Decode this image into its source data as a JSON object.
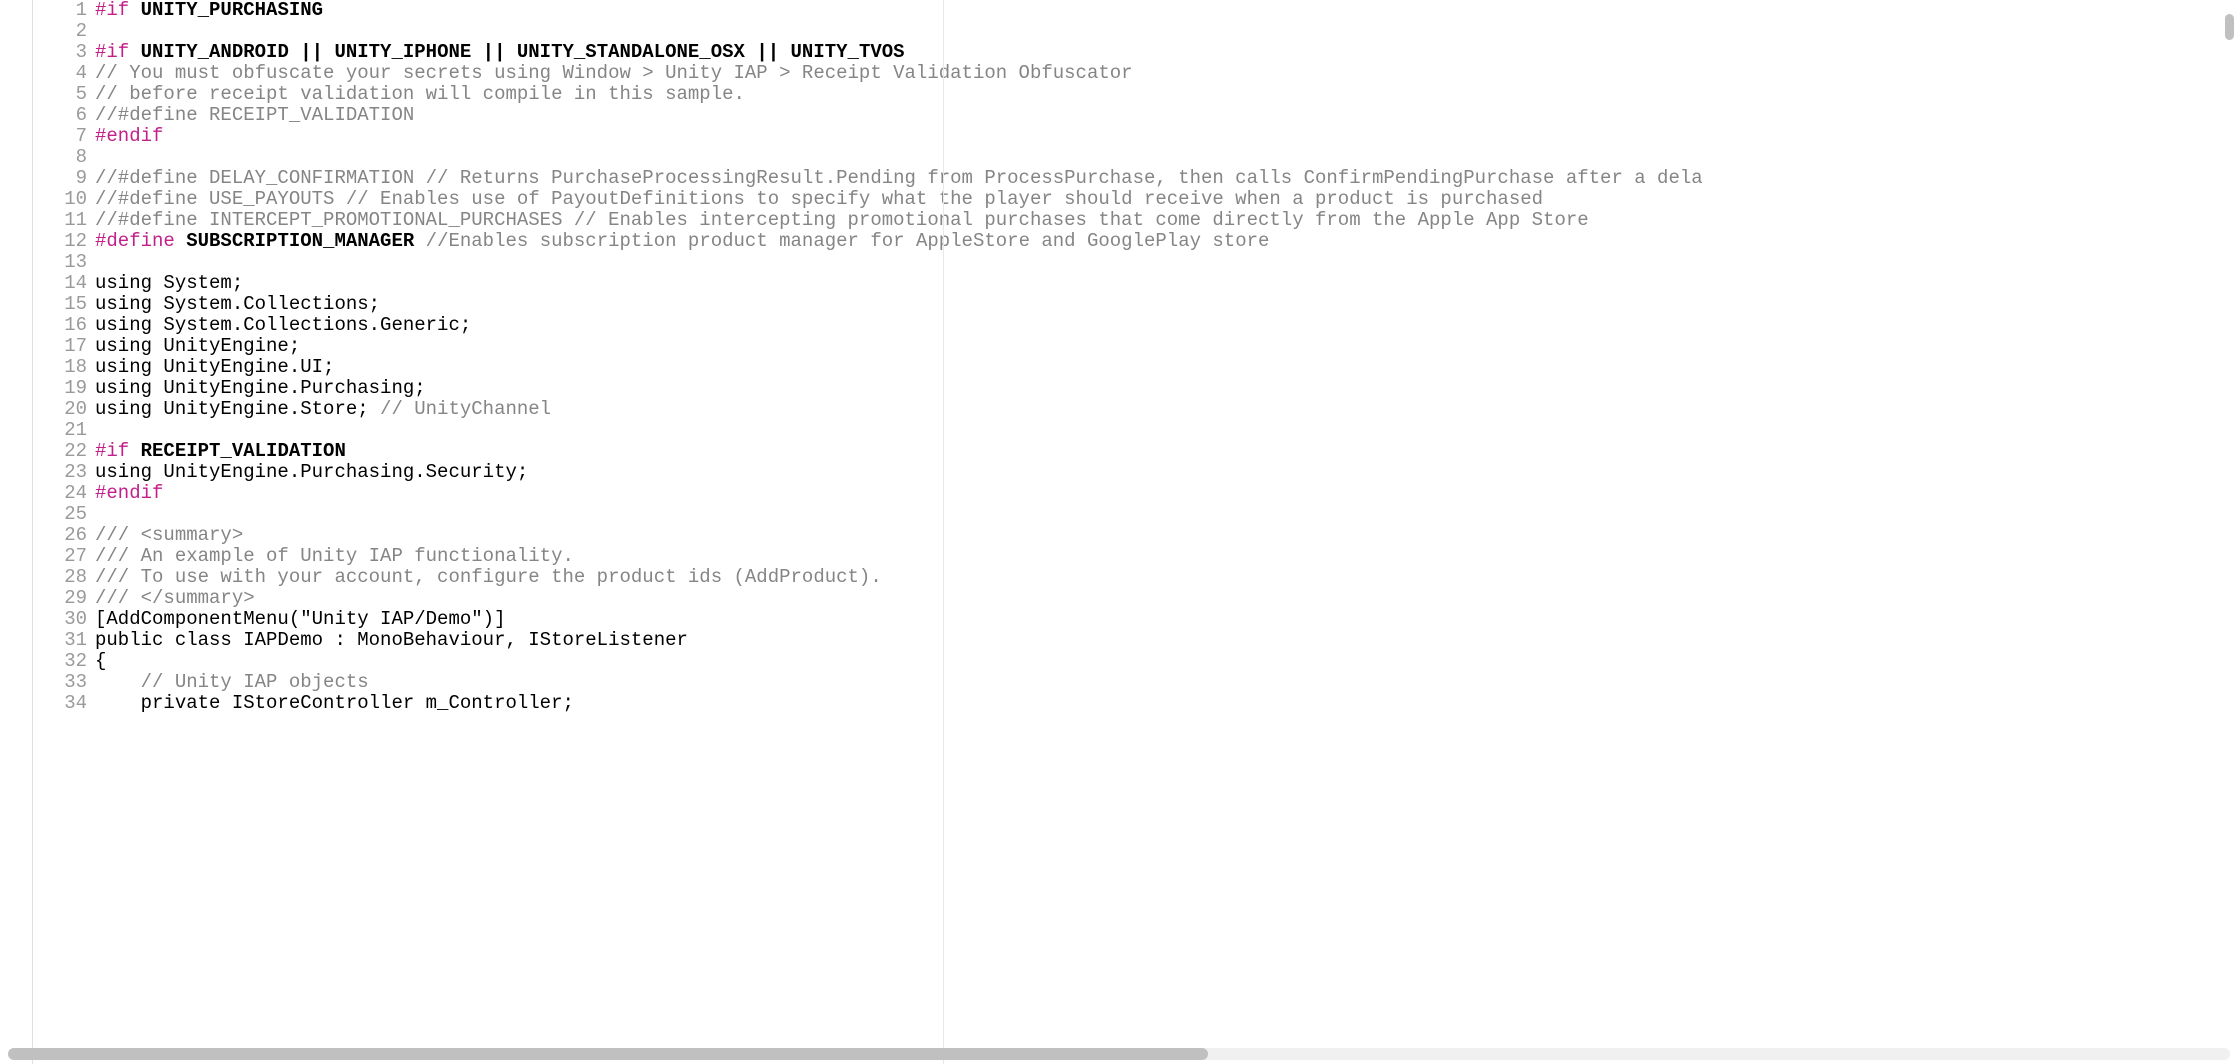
{
  "lines": [
    {
      "n": 1,
      "segments": [
        {
          "cls": "tok-preproc",
          "t": "#if"
        },
        {
          "cls": "tok-bold",
          "t": " UNITY_PURCHASING"
        }
      ]
    },
    {
      "n": 2,
      "segments": []
    },
    {
      "n": 3,
      "segments": [
        {
          "cls": "tok-preproc",
          "t": "#if"
        },
        {
          "cls": "tok-bold",
          "t": " UNITY_ANDROID || UNITY_IPHONE || UNITY_STANDALONE_OSX || UNITY_TVOS"
        }
      ]
    },
    {
      "n": 4,
      "segments": [
        {
          "cls": "tok-comment",
          "t": "// You must obfuscate your secrets using Window > Unity IAP > Receipt Validation Obfuscator"
        }
      ]
    },
    {
      "n": 5,
      "segments": [
        {
          "cls": "tok-comment",
          "t": "// before receipt validation will compile in this sample."
        }
      ]
    },
    {
      "n": 6,
      "segments": [
        {
          "cls": "tok-comment",
          "t": "//#define RECEIPT_VALIDATION"
        }
      ]
    },
    {
      "n": 7,
      "segments": [
        {
          "cls": "tok-preproc",
          "t": "#endif"
        }
      ]
    },
    {
      "n": 8,
      "segments": []
    },
    {
      "n": 9,
      "segments": [
        {
          "cls": "tok-comment",
          "t": "//#define DELAY_CONFIRMATION // Returns PurchaseProcessingResult.Pending from ProcessPurchase, then calls ConfirmPendingPurchase after a dela"
        }
      ]
    },
    {
      "n": 10,
      "segments": [
        {
          "cls": "tok-comment",
          "t": "//#define USE_PAYOUTS // Enables use of PayoutDefinitions to specify what the player should receive when a product is purchased"
        }
      ]
    },
    {
      "n": 11,
      "segments": [
        {
          "cls": "tok-comment",
          "t": "//#define INTERCEPT_PROMOTIONAL_PURCHASES // Enables intercepting promotional purchases that come directly from the Apple App Store"
        }
      ]
    },
    {
      "n": 12,
      "segments": [
        {
          "cls": "tok-preproc",
          "t": "#define"
        },
        {
          "cls": "tok-bold",
          "t": " SUBSCRIPTION_MANAGER "
        },
        {
          "cls": "tok-comment",
          "t": "//Enables subscription product manager for AppleStore and GooglePlay store"
        }
      ]
    },
    {
      "n": 13,
      "segments": []
    },
    {
      "n": 14,
      "segments": [
        {
          "cls": "tok-plain",
          "t": "using System;"
        }
      ]
    },
    {
      "n": 15,
      "segments": [
        {
          "cls": "tok-plain",
          "t": "using System.Collections;"
        }
      ]
    },
    {
      "n": 16,
      "segments": [
        {
          "cls": "tok-plain",
          "t": "using System.Collections.Generic;"
        }
      ]
    },
    {
      "n": 17,
      "segments": [
        {
          "cls": "tok-plain",
          "t": "using UnityEngine;"
        }
      ]
    },
    {
      "n": 18,
      "segments": [
        {
          "cls": "tok-plain",
          "t": "using UnityEngine.UI;"
        }
      ]
    },
    {
      "n": 19,
      "segments": [
        {
          "cls": "tok-plain",
          "t": "using UnityEngine.Purchasing;"
        }
      ]
    },
    {
      "n": 20,
      "segments": [
        {
          "cls": "tok-plain",
          "t": "using UnityEngine.Store; "
        },
        {
          "cls": "tok-comment",
          "t": "// UnityChannel"
        }
      ]
    },
    {
      "n": 21,
      "segments": []
    },
    {
      "n": 22,
      "segments": [
        {
          "cls": "tok-preproc",
          "t": "#if"
        },
        {
          "cls": "tok-bold",
          "t": " RECEIPT_VALIDATION"
        }
      ]
    },
    {
      "n": 23,
      "segments": [
        {
          "cls": "tok-plain",
          "t": "using UnityEngine.Purchasing.Security;"
        }
      ]
    },
    {
      "n": 24,
      "segments": [
        {
          "cls": "tok-preproc",
          "t": "#endif"
        }
      ]
    },
    {
      "n": 25,
      "segments": []
    },
    {
      "n": 26,
      "segments": [
        {
          "cls": "tok-comment",
          "t": "/// <summary>"
        }
      ]
    },
    {
      "n": 27,
      "segments": [
        {
          "cls": "tok-comment",
          "t": "/// An example of Unity IAP functionality."
        }
      ]
    },
    {
      "n": 28,
      "segments": [
        {
          "cls": "tok-comment",
          "t": "/// To use with your account, configure the product ids (AddProduct)."
        }
      ]
    },
    {
      "n": 29,
      "segments": [
        {
          "cls": "tok-comment",
          "t": "/// </summary>"
        }
      ]
    },
    {
      "n": 30,
      "segments": [
        {
          "cls": "tok-plain",
          "t": "[AddComponentMenu(\"Unity IAP/Demo\")]"
        }
      ]
    },
    {
      "n": 31,
      "segments": [
        {
          "cls": "tok-plain",
          "t": "public class IAPDemo : MonoBehaviour, IStoreListener"
        }
      ]
    },
    {
      "n": 32,
      "segments": [
        {
          "cls": "tok-plain",
          "t": "{"
        }
      ]
    },
    {
      "n": 33,
      "segments": [
        {
          "cls": "tok-plain",
          "t": "    "
        },
        {
          "cls": "tok-comment",
          "t": "// Unity IAP objects"
        }
      ]
    },
    {
      "n": 34,
      "segments": [
        {
          "cls": "tok-plain",
          "t": "    private IStoreController m_Controller;"
        }
      ]
    }
  ]
}
